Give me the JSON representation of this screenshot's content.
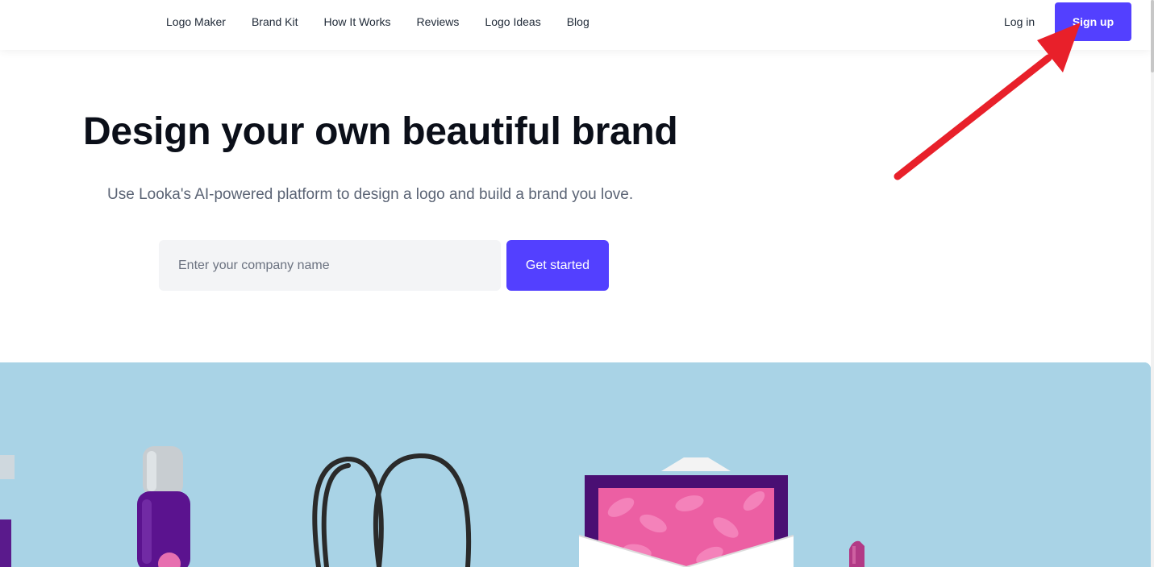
{
  "nav": {
    "links": [
      "Logo Maker",
      "Brand Kit",
      "How It Works",
      "Reviews",
      "Logo Ideas",
      "Blog"
    ],
    "login_label": "Log in",
    "signup_label": "Sign up"
  },
  "hero": {
    "title": "Design your own beautiful brand",
    "subtitle": "Use Looka's AI-powered platform to design a logo and build a brand you love.",
    "input_placeholder": "Enter your company name",
    "input_value": "",
    "cta_label": "Get started"
  },
  "showcase": {
    "items": [
      "spray-bottle",
      "shopping-bag",
      "envelope",
      "lipstick"
    ]
  },
  "annotation": {
    "type": "arrow",
    "color": "#e8202a",
    "points_to": "signup-button"
  },
  "colors": {
    "accent": "#5340ff",
    "hero_background": "#ffffff",
    "showcase_background": "#a9d3e6",
    "annotation": "#e8202a"
  }
}
